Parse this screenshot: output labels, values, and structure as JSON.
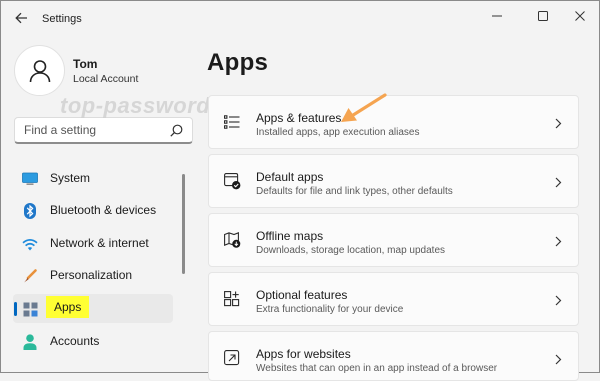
{
  "window": {
    "title": "Settings"
  },
  "profile": {
    "name": "Tom",
    "account_type": "Local Account"
  },
  "search": {
    "placeholder": "Find a setting"
  },
  "nav": {
    "items": [
      {
        "label": "System",
        "icon": "monitor-icon"
      },
      {
        "label": "Bluetooth & devices",
        "icon": "bluetooth-icon"
      },
      {
        "label": "Network & internet",
        "icon": "wifi-icon"
      },
      {
        "label": "Personalization",
        "icon": "brush-icon"
      },
      {
        "label": "Apps",
        "icon": "apps-icon",
        "active": true
      },
      {
        "label": "Accounts",
        "icon": "person-icon"
      }
    ]
  },
  "main": {
    "title": "Apps",
    "cards": [
      {
        "title": "Apps & features",
        "description": "Installed apps, app execution aliases",
        "icon": "list-icon"
      },
      {
        "title": "Default apps",
        "description": "Defaults for file and link types, other defaults",
        "icon": "default-apps-icon"
      },
      {
        "title": "Offline maps",
        "description": "Downloads, storage location, map updates",
        "icon": "map-icon"
      },
      {
        "title": "Optional features",
        "description": "Extra functionality for your device",
        "icon": "grid-plus-icon"
      },
      {
        "title": "Apps for websites",
        "description": "Websites that can open in an app instead of a browser",
        "icon": "external-link-icon"
      }
    ]
  },
  "watermark": "top-password.com",
  "colors": {
    "accent": "#0067c0",
    "highlight": "#ffff33",
    "annotation_arrow": "#f5a450"
  }
}
